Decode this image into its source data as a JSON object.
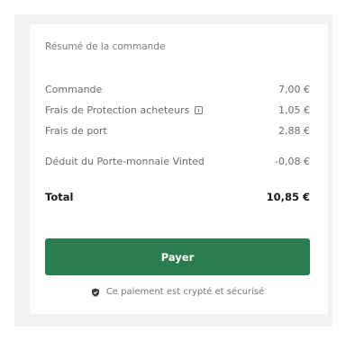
{
  "summary": {
    "title": "Résumé de la commande",
    "lines": [
      {
        "label": "Commande",
        "value": "7,00 €"
      },
      {
        "label": "Frais de Protection acheteurs",
        "value": "1,05 €"
      },
      {
        "label": "Frais de port",
        "value": "2,88 €"
      },
      {
        "label": "Déduit du Porte-monnaie Vinted",
        "value": "-0,08 €"
      }
    ],
    "total_label": "Total",
    "total_value": "10,85 €"
  },
  "pay_button": {
    "label": "Payer"
  },
  "secure_note": {
    "text": "Ce paiement est crypté et sécurisé"
  },
  "colors": {
    "accent": "#2a7d51",
    "background_frame": "#f2f2f2",
    "card": "#ffffff"
  },
  "icons": {
    "info": "info-icon",
    "secure": "shield-check-icon"
  }
}
